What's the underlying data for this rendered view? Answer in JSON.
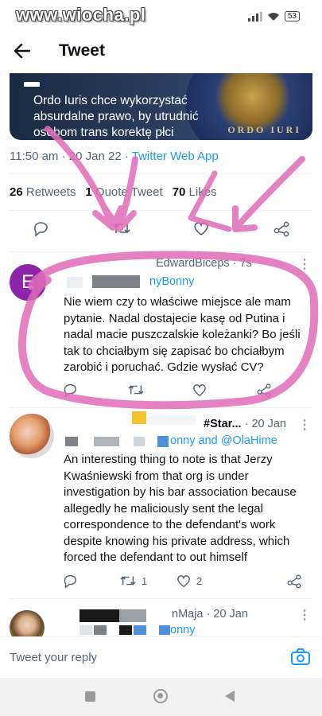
{
  "status_bar": {
    "watermark": "www.wiocha.pl",
    "battery": "53"
  },
  "appbar": {
    "title": "Tweet"
  },
  "card": {
    "headline": "Ordo Iuris chce wykorzystać absurdalne prawo, by utrudnić osobom trans korektę płci",
    "seal_text": "ORDO IURI"
  },
  "main_tweet": {
    "time": "11:50 am",
    "date": "20 Jan 22",
    "source": "Twitter Web App",
    "retweets_count": "26",
    "retweets_label": "Retweets",
    "quotes_count": "1",
    "quotes_label": "Quote Tweet",
    "likes_count": "70",
    "likes_label": "Likes"
  },
  "replies": [
    {
      "avatar_letter": "E",
      "name": "EdwardBiceps",
      "time": "· 7s",
      "reply_to": "nyBonny",
      "body": "Nie wiem czy to właściwe miejsce ale mam pytanie. Nadal dostajecie kasę od Putina i nadal macie puszczalskie koleżanki? Bo jeśli tak to chciałbym się zapisać bo chciałbym zarobić i poruchać. Gdzie wysłać CV?"
    },
    {
      "name": "#Star...",
      "time": "· 20 Jan",
      "reply_to": "onny and @OlaHime",
      "body": "An interesting thing to note is that Jerzy Kwaśniewski from that org is under investigation by his bar association because allegedly he maliciously sent the legal correspondence to the defendant's work despite knowing his private address, which forced the defendant to out himself",
      "retweets": "1",
      "likes": "2"
    },
    {
      "name": "nMaja",
      "time": "· 20 Jan",
      "reply_to": "onny"
    }
  ],
  "compose": {
    "placeholder": "Tweet your reply"
  },
  "colors": {
    "accent": "#1d9bf0",
    "annotation": "#e06cb8",
    "avatar_e": "#8e24aa"
  }
}
